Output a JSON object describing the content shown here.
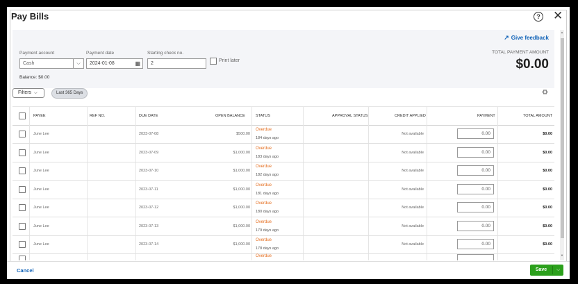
{
  "dialog": {
    "title": "Pay Bills"
  },
  "header": {
    "give_feedback": "Give feedback",
    "payment_account_label": "Payment account",
    "payment_account_value": "Cash",
    "payment_date_label": "Payment date",
    "payment_date_value": "2024-01-08",
    "starting_check_label": "Starting check no.",
    "starting_check_value": "2",
    "print_later_label": "Print later",
    "balance_text": "Balance: $0.00",
    "total_payment_label": "TOTAL PAYMENT AMOUNT",
    "total_payment_value": "$0.00"
  },
  "filters": {
    "filters_label": "Filters",
    "chip_label": "Last 365 Days"
  },
  "table": {
    "columns": {
      "payee": "PAYEE",
      "ref_no": "REF NO.",
      "due_date": "DUE DATE",
      "open_balance": "OPEN BALANCE",
      "status": "STATUS",
      "approval_status": "APPROVAL STATUS",
      "credit_applied": "CREDIT APPLIED",
      "payment": "PAYMENT",
      "total_amount": "TOTAL AMOUNT"
    },
    "rows": [
      {
        "payee": "June Lee",
        "ref": "",
        "due": "2023-07-08",
        "balance": "$500.00",
        "status": "Overdue",
        "ago": "184 days ago",
        "credit": "Not available",
        "payment": "0.00",
        "total": "$0.00"
      },
      {
        "payee": "June Lee",
        "ref": "",
        "due": "2023-07-09",
        "balance": "$1,000.00",
        "status": "Overdue",
        "ago": "183 days ago",
        "credit": "Not available",
        "payment": "0.00",
        "total": "$0.00"
      },
      {
        "payee": "June Lee",
        "ref": "",
        "due": "2023-07-10",
        "balance": "$1,000.00",
        "status": "Overdue",
        "ago": "182 days ago",
        "credit": "Not available",
        "payment": "0.00",
        "total": "$0.00"
      },
      {
        "payee": "June Lee",
        "ref": "",
        "due": "2023-07-11",
        "balance": "$1,000.00",
        "status": "Overdue",
        "ago": "181 days ago",
        "credit": "Not available",
        "payment": "0.00",
        "total": "$0.00"
      },
      {
        "payee": "June Lee",
        "ref": "",
        "due": "2023-07-12",
        "balance": "$1,000.00",
        "status": "Overdue",
        "ago": "180 days ago",
        "credit": "Not available",
        "payment": "0.00",
        "total": "$0.00"
      },
      {
        "payee": "June Lee",
        "ref": "",
        "due": "2023-07-13",
        "balance": "$1,000.00",
        "status": "Overdue",
        "ago": "179 days ago",
        "credit": "Not available",
        "payment": "0.00",
        "total": "$0.00"
      },
      {
        "payee": "June Lee",
        "ref": "",
        "due": "2023-07-14",
        "balance": "$1,000.00",
        "status": "Overdue",
        "ago": "178 days ago",
        "credit": "Not available",
        "payment": "0.00",
        "total": "$0.00"
      },
      {
        "payee": "",
        "ref": "",
        "due": "",
        "balance": "",
        "status": "Overdue",
        "ago": "",
        "credit": "",
        "payment": "",
        "total": ""
      }
    ]
  },
  "footer": {
    "cancel_label": "Cancel",
    "save_label": "Save"
  },
  "colors": {
    "accent_blue": "#1163b8",
    "save_green": "#2ca01c",
    "overdue_orange": "#e46b1b"
  }
}
